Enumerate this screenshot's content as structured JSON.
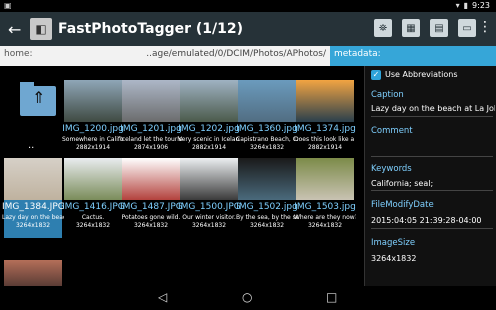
{
  "status_bar": {
    "left_icon": "image-icon",
    "time": "9:23"
  },
  "action_bar": {
    "back_icon": "back-arrow-icon",
    "title": "FastPhotoTagger (1/12)",
    "toolbar_icons": [
      "tag-icon",
      "grid-icon",
      "save-icon",
      "screen-icon",
      "overflow-icon"
    ]
  },
  "path_row": {
    "home_label": "home:",
    "path_value": "..age/emulated/0/DCIM/Photos/APhotos/",
    "metadata_label": "metadata:"
  },
  "grid": [
    {
      "type": "folder",
      "label": ".."
    },
    {
      "filename": "IMG_1200.jpg",
      "caption": "Somewhere in Califon",
      "dimensions": "2882x1914"
    },
    {
      "filename": "IMG_1201.jpg",
      "caption": "Iceland let the tourist",
      "dimensions": "2874x1906"
    },
    {
      "filename": "IMG_1202.jpg",
      "caption": "Very scenic in Iceland",
      "dimensions": "2882x1914"
    },
    {
      "filename": "IMG_1360.jpg",
      "caption": "Capistrano Beach, Cal",
      "dimensions": "3264x1832"
    },
    {
      "filename": "IMG_1374.jpg",
      "caption": "Does this look like a f",
      "dimensions": "2882x1914"
    },
    {
      "filename": "IMG_1384.JPG",
      "caption": "Lazy day on the beach",
      "dimensions": "3264x1832",
      "selected": true
    },
    {
      "filename": "IMG_1416.JPG",
      "caption": "Cactus.",
      "dimensions": "3264x1832"
    },
    {
      "filename": "IMG_1487.JPG",
      "caption": "Potatoes gone wild.",
      "dimensions": "3264x1832"
    },
    {
      "filename": "IMG_1500.JPG",
      "caption": "Our winter visitor.",
      "dimensions": "3264x1832"
    },
    {
      "filename": "IMG_1502.jpg",
      "caption": "By the sea, by the sea",
      "dimensions": "3264x1832"
    },
    {
      "filename": "IMG_1503.jpg",
      "caption": "Where are they now?",
      "dimensions": "3264x1832"
    }
  ],
  "metadata_panel": {
    "use_abbreviations_label": "Use Abbreviations",
    "caption_head": "Caption",
    "caption_value": "Lazy day on the beach at La Jolla",
    "comment_head": "Comment",
    "keywords_head": "Keywords",
    "keywords_value": "California; seal;",
    "file_modify_head": "FileModifyDate",
    "file_modify_value": "2015:04:05 21:39:28-04:00",
    "image_size_head": "ImageSize",
    "image_size_value": "3264x1832"
  },
  "nav_bar": {
    "back": "◁",
    "home": "○",
    "recents": "□"
  }
}
